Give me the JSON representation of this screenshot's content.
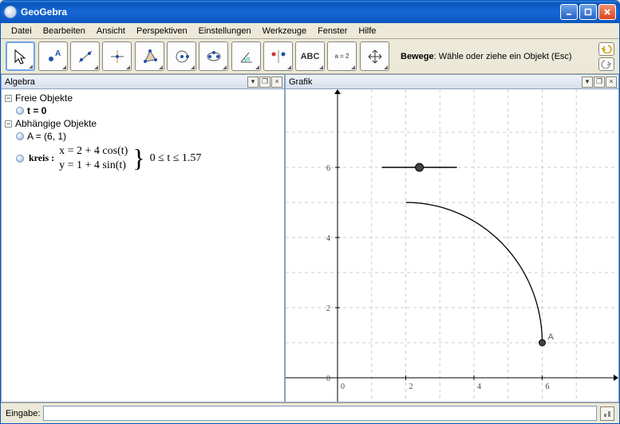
{
  "window": {
    "title": "GeoGebra"
  },
  "menu": {
    "file": "Datei",
    "edit": "Bearbeiten",
    "view": "Ansicht",
    "perspectives": "Perspektiven",
    "settings": "Einstellungen",
    "tools": "Werkzeuge",
    "window": "Fenster",
    "help": "Hilfe"
  },
  "toolbar": {
    "status_bold": "Bewege",
    "status_rest": ": Wähle oder ziehe ein Objekt (Esc)",
    "abc": "ABC",
    "a2": "a = 2"
  },
  "panels": {
    "algebra": "Algebra",
    "graphic": "Grafik"
  },
  "tree": {
    "free": "Freie Objekte",
    "t_eq": "t = 0",
    "dep": "Abhängige Objekte",
    "A_eq": "A = (6, 1)",
    "kreis_name": "kreis :",
    "eq1": "x = 2 + 4 cos(t)",
    "eq2": "y = 1 + 4 sin(t)",
    "range": "0 ≤ t ≤ 1.57"
  },
  "statusbar": {
    "label": "Eingabe:"
  },
  "chart_data": {
    "type": "line",
    "title": "",
    "xlabel": "",
    "ylabel": "",
    "xlim": [
      -0.5,
      7.5
    ],
    "ylim": [
      -0.5,
      7.5
    ],
    "xticks": [
      0,
      2,
      4,
      6
    ],
    "yticks": [
      0,
      2,
      4,
      6
    ],
    "series": [
      {
        "name": "kreis",
        "type": "parametric_arc",
        "center": [
          2,
          1
        ],
        "radius": 4,
        "t0": 0,
        "t1": 1.57
      }
    ],
    "points": [
      {
        "name": "A",
        "x": 6,
        "y": 1
      }
    ],
    "slider": {
      "name": "t",
      "value": 0,
      "x0": 1.3,
      "x1": 3.5,
      "y": 6
    }
  }
}
